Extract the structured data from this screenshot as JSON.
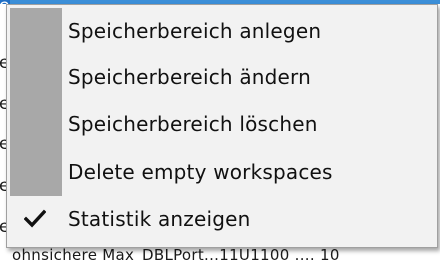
{
  "background": {
    "rows": [
      "e",
      "e",
      "e",
      "e",
      "e",
      "e"
    ],
    "bottom_row_text": "ohnsichere Max_DBLPort...11U1100 .... 10"
  },
  "context_menu": {
    "items": [
      {
        "label": "Speicherbereich anlegen",
        "checked": false
      },
      {
        "label": "Speicherbereich ändern",
        "checked": false
      },
      {
        "label": "Speicherbereich löschen",
        "checked": false
      },
      {
        "label": "Delete empty workspaces",
        "checked": false
      },
      {
        "label": "Statistik anzeigen",
        "checked": true
      }
    ],
    "check_icon": "checkmark-icon"
  },
  "colors": {
    "menu_background": "#f2f2f2",
    "gutter": "#a8a8a8",
    "menu_border": "#a0a0a0",
    "text": "#111111",
    "selection_accent": "#3c8fd8"
  }
}
